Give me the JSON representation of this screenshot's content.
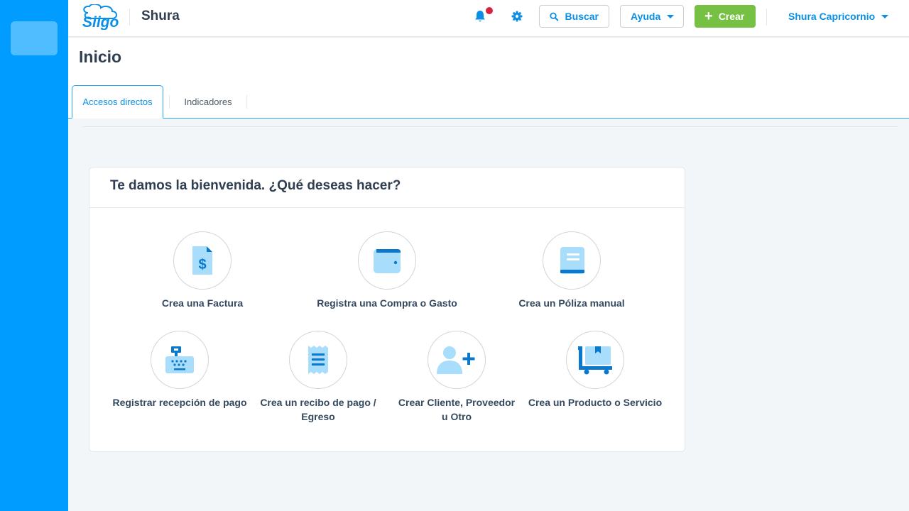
{
  "header": {
    "company_name": "Shura",
    "search_label": "Buscar",
    "help_label": "Ayuda",
    "create_label": "Crear",
    "user_name": "Shura Capricornio"
  },
  "page": {
    "title": "Inicio",
    "tabs": [
      {
        "label": "Accesos directos",
        "active": true
      },
      {
        "label": "Indicadores",
        "active": false
      }
    ]
  },
  "welcome": {
    "title": "Te damos la bienvenida. ¿Qué deseas hacer?",
    "actions": [
      {
        "label": "Crea una Factura",
        "icon": "invoice-icon"
      },
      {
        "label": "Registra una Compra o Gasto",
        "icon": "wallet-icon"
      },
      {
        "label": "Crea un Póliza manual",
        "icon": "book-icon"
      },
      {
        "label": "Registrar recepción de pago",
        "icon": "cash-register-icon"
      },
      {
        "label": "Crea un recibo de pago / Egreso",
        "icon": "receipt-icon"
      },
      {
        "label": "Crear Cliente, Proveedor u Otro",
        "icon": "add-user-icon"
      },
      {
        "label": "Crea un Producto o Servicio",
        "icon": "product-cart-icon"
      }
    ]
  },
  "colors": {
    "sidebar": "#009cff",
    "accent": "#0a8fe6",
    "create_button": "#76c043",
    "notification_dot": "#d6233d",
    "icon_light": "#a9ddfc",
    "icon_dark": "#0a78cc"
  }
}
